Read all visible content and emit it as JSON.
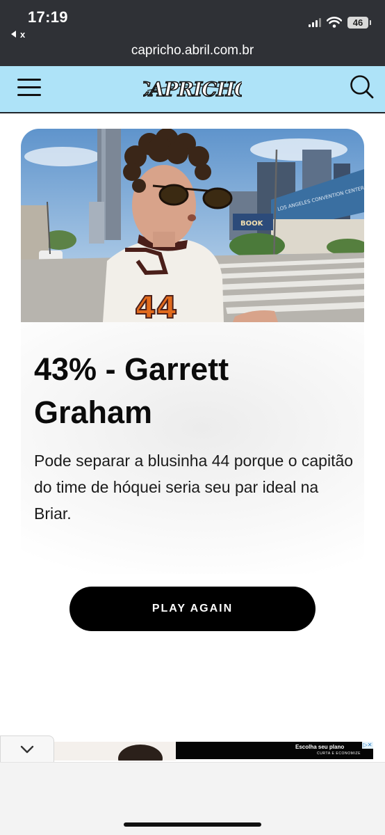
{
  "status_bar": {
    "time": "17:19",
    "back_label": "x",
    "battery": "46"
  },
  "browser": {
    "url": "capricho.abril.com.br"
  },
  "site": {
    "logo_text": "CAPRICHO"
  },
  "result": {
    "title": "43% - Garrett Graham",
    "description": "Pode separar a blusinha 44 porque o capitão do time de hóquei seria seu par ideal na Briar.",
    "jersey_number": "44",
    "street_sign_text": "BOOK",
    "building_sign_text": "LOS ANGELES CONVENTION CENTER"
  },
  "actions": {
    "play_again_label": "PLAY AGAIN"
  },
  "ad": {
    "headline": "Escolha seu plano",
    "subline": "CURTA E ECONOMIZE"
  },
  "colors": {
    "header_bg": "#aee3f8",
    "status_bg": "#2f3136",
    "button_bg": "#000000"
  },
  "icons": [
    "signal-icon",
    "wifi-icon",
    "battery-icon",
    "menu-icon",
    "search-icon",
    "chevron-down-icon"
  ]
}
